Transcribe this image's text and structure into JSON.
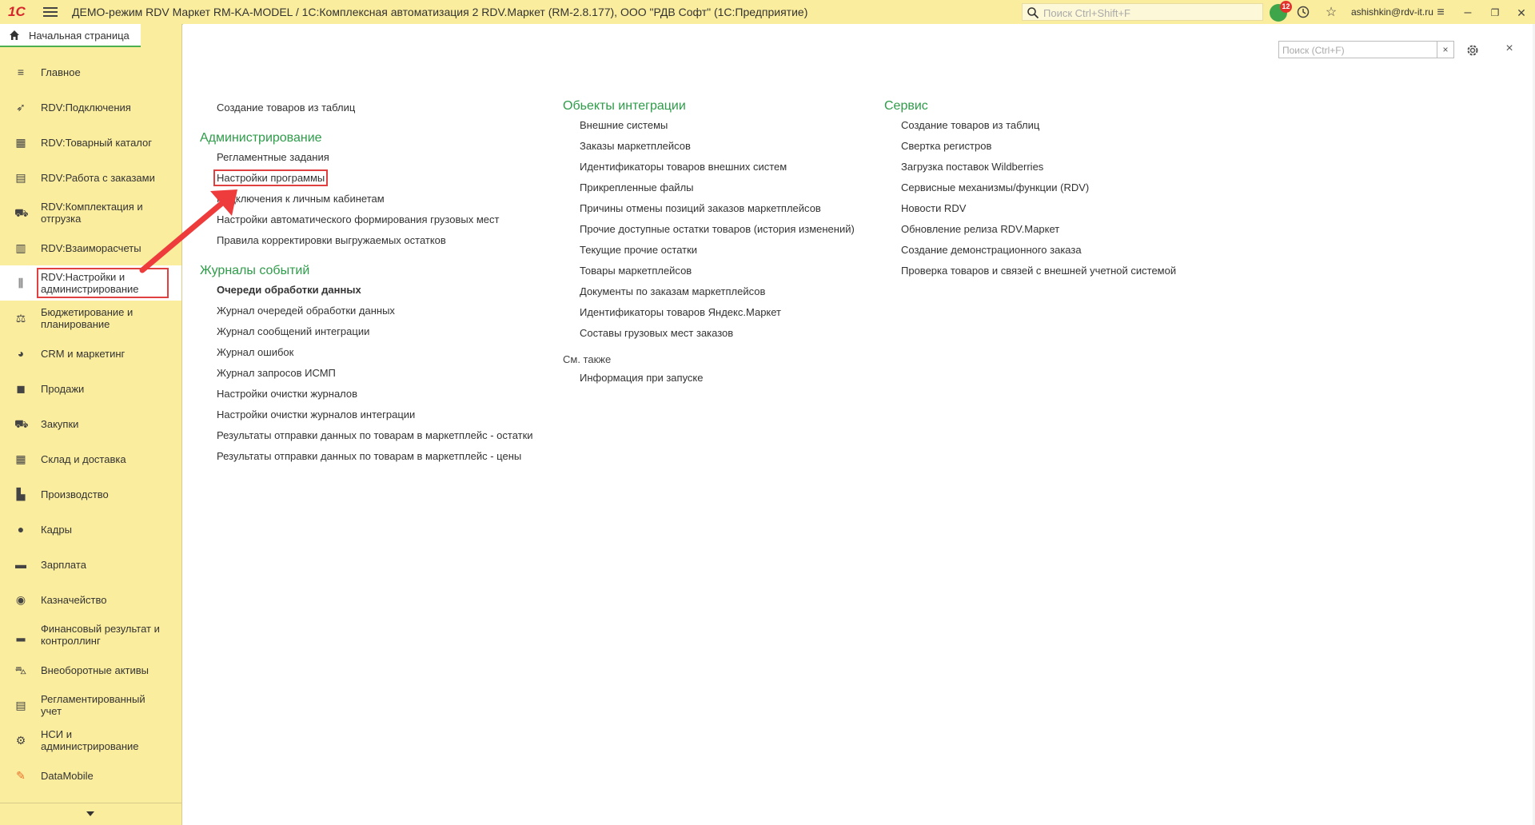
{
  "window": {
    "title": "ДЕМО-режим RDV Маркет RM-KA-MODEL / 1С:Комплексная автоматизация 2 RDV.Маркет (RM-2.8.177), ООО \"РДВ Софт\"  (1С:Предприятие)",
    "logo": "1С",
    "global_search_placeholder": "Поиск Ctrl+Shift+F",
    "notification_count": "12",
    "user": "ashishkin@rdv-it.ru"
  },
  "sidebar": {
    "home_tab": "Начальная страница",
    "items": [
      {
        "label": "Главное",
        "icon": "list-icon"
      },
      {
        "label": "RDV:Подключения",
        "icon": "rocket-icon"
      },
      {
        "label": "RDV:Товарный каталог",
        "icon": "grid-icon"
      },
      {
        "label": "RDV:Работа с заказами",
        "icon": "document-icon"
      },
      {
        "label": "RDV:Комплектация и отгрузка",
        "icon": "cart-icon"
      },
      {
        "label": "RDV:Взаиморасчеты",
        "icon": "calculator-icon"
      },
      {
        "label": "RDV:Настройки и администрирование",
        "icon": "sliders-icon",
        "active": true
      },
      {
        "label": "Бюджетирование и планирование",
        "icon": "scales-icon"
      },
      {
        "label": "CRM и маркетинг",
        "icon": "pie-icon"
      },
      {
        "label": "Продажи",
        "icon": "bag-icon"
      },
      {
        "label": "Закупки",
        "icon": "cart-icon"
      },
      {
        "label": "Склад и доставка",
        "icon": "warehouse-icon"
      },
      {
        "label": "Производство",
        "icon": "factory-icon"
      },
      {
        "label": "Кадры",
        "icon": "person-icon"
      },
      {
        "label": "Зарплата",
        "icon": "wallet-icon"
      },
      {
        "label": "Казначейство",
        "icon": "coin-icon"
      },
      {
        "label": "Финансовый результат и контроллинг",
        "icon": "bar-chart-icon"
      },
      {
        "label": "Внеоборотные активы",
        "icon": "truck-icon"
      },
      {
        "label": "Регламентированный учет",
        "icon": "ledger-icon"
      },
      {
        "label": "НСИ и администрирование",
        "icon": "gear-icon"
      },
      {
        "label": "DataMobile",
        "icon": "datamobile-icon"
      }
    ]
  },
  "main": {
    "search_placeholder": "Поиск (Ctrl+F)",
    "col1": {
      "top_links": [
        "Создание товаров из таблиц"
      ],
      "admin_title": "Администрирование",
      "admin_links": [
        "Регламентные задания",
        "Настройки программы",
        "Подключения к личным кабинетам",
        "Настройки автоматического формирования грузовых мест",
        "Правила корректировки выгружаемых остатков"
      ],
      "journals_title": "Журналы событий",
      "journals_links": [
        "Очереди обработки данных",
        "Журнал очередей обработки данных",
        "Журнал сообщений интеграции",
        "Журнал ошибок",
        "Журнал запросов ИСМП",
        "Настройки очистки журналов",
        "Настройки очистки журналов интеграции",
        "Результаты отправки данных по товарам в маркетплейс - остатки",
        "Результаты отправки данных по товарам в маркетплейс - цены"
      ]
    },
    "col2": {
      "objects_title": "Обьекты интеграции",
      "objects_links": [
        "Внешние системы",
        "Заказы маркетплейсов",
        "Идентификаторы товаров внешних систем",
        "Прикрепленные файлы",
        "Причины отмены позиций заказов маркетплейсов",
        "Прочие доступные остатки товаров (история изменений)",
        "Текущие прочие остатки",
        "Товары маркетплейсов",
        "Документы по заказам маркетплейсов",
        "Идентификаторы товаров Яндекс.Маркет",
        "Составы грузовых мест заказов"
      ],
      "see_also_title": "См. также",
      "see_also_links": [
        "Информация при запуске"
      ]
    },
    "col3": {
      "service_title": "Сервис",
      "service_links": [
        "Создание товаров из таблиц",
        "Свертка регистров",
        "Загрузка поставок Wildberries",
        "Сервисные механизмы/функции (RDV)",
        "Новости RDV",
        "Обновление релиза RDV.Маркет",
        "Создание демонстрационного заказа",
        "Проверка товаров и связей с внешней учетной системой"
      ]
    }
  },
  "colors": {
    "panel": "#fbed9e",
    "group_title": "#2e9c49",
    "highlight": "#e04040"
  }
}
